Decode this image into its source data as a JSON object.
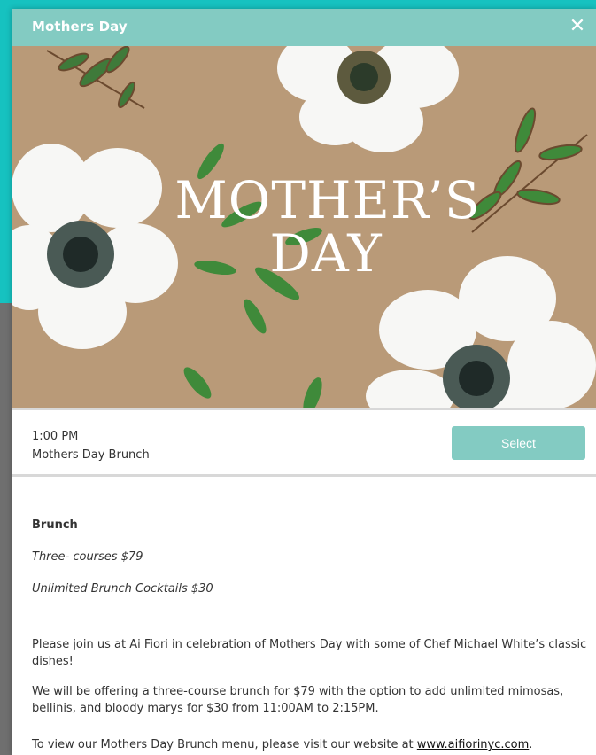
{
  "modal": {
    "title": "Mothers Day",
    "close_symbol": "✕"
  },
  "hero": {
    "title_line1": "MOTHER’S",
    "title_line2": "DAY"
  },
  "slot": {
    "time": "1:00 PM",
    "name": "Mothers Day Brunch",
    "select_label": "Select"
  },
  "details": {
    "heading": "Brunch",
    "price_line1": "Three- courses $79",
    "price_line2": "Unlimited Brunch Cocktails $30",
    "para1": "Please join us at Ai Fiori in celebration of Mothers Day with some of Chef Michael White’s classic dishes!",
    "para2": "We will be offering a three-course brunch for $79 with the option to add unlimited mimosas, bellinis, and bloody marys for $30 from 11:00AM to 2:15PM.",
    "para3_prefix": "To view our Mothers Day Brunch menu, please visit our website at ",
    "para3_link": "www.aifiorinyc.com",
    "para3_suffix": "."
  },
  "colors": {
    "header_bg": "#83cbc2",
    "button_bg": "#83cbc2",
    "backdrop_teal": "#16c2c0",
    "hero_bg": "#b99a78"
  },
  "icons": {
    "close": "close-icon"
  }
}
